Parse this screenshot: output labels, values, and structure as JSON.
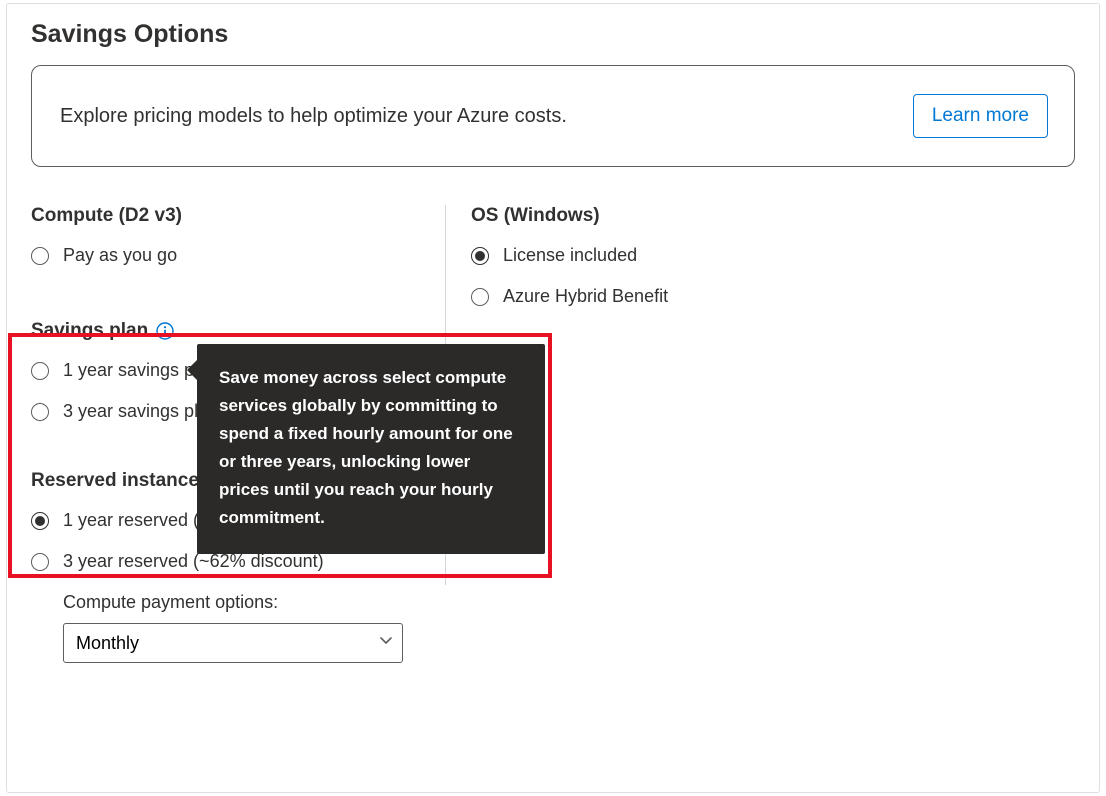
{
  "title": "Savings Options",
  "banner": {
    "text": "Explore pricing models to help optimize your Azure costs.",
    "learn_more": "Learn more"
  },
  "compute": {
    "heading": "Compute (D2 v3)",
    "payg": "Pay as you go"
  },
  "savings_plan": {
    "heading": "Savings plan",
    "opt1": "1 year savings plan",
    "opt2": "3 year savings plan"
  },
  "reserved": {
    "heading": "Reserved instances",
    "opt1": "1 year reserved (~40% discount)",
    "opt2": "3 year reserved (~62% discount)",
    "pay_label": "Compute payment options:",
    "pay_value": "Monthly"
  },
  "os": {
    "heading": "OS (Windows)",
    "opt1": "License included",
    "opt2": "Azure Hybrid Benefit"
  },
  "tooltip": "Save money across select compute services globally by committing to spend a fixed hourly amount for one or three years, unlocking lower prices until you reach your hourly commitment."
}
